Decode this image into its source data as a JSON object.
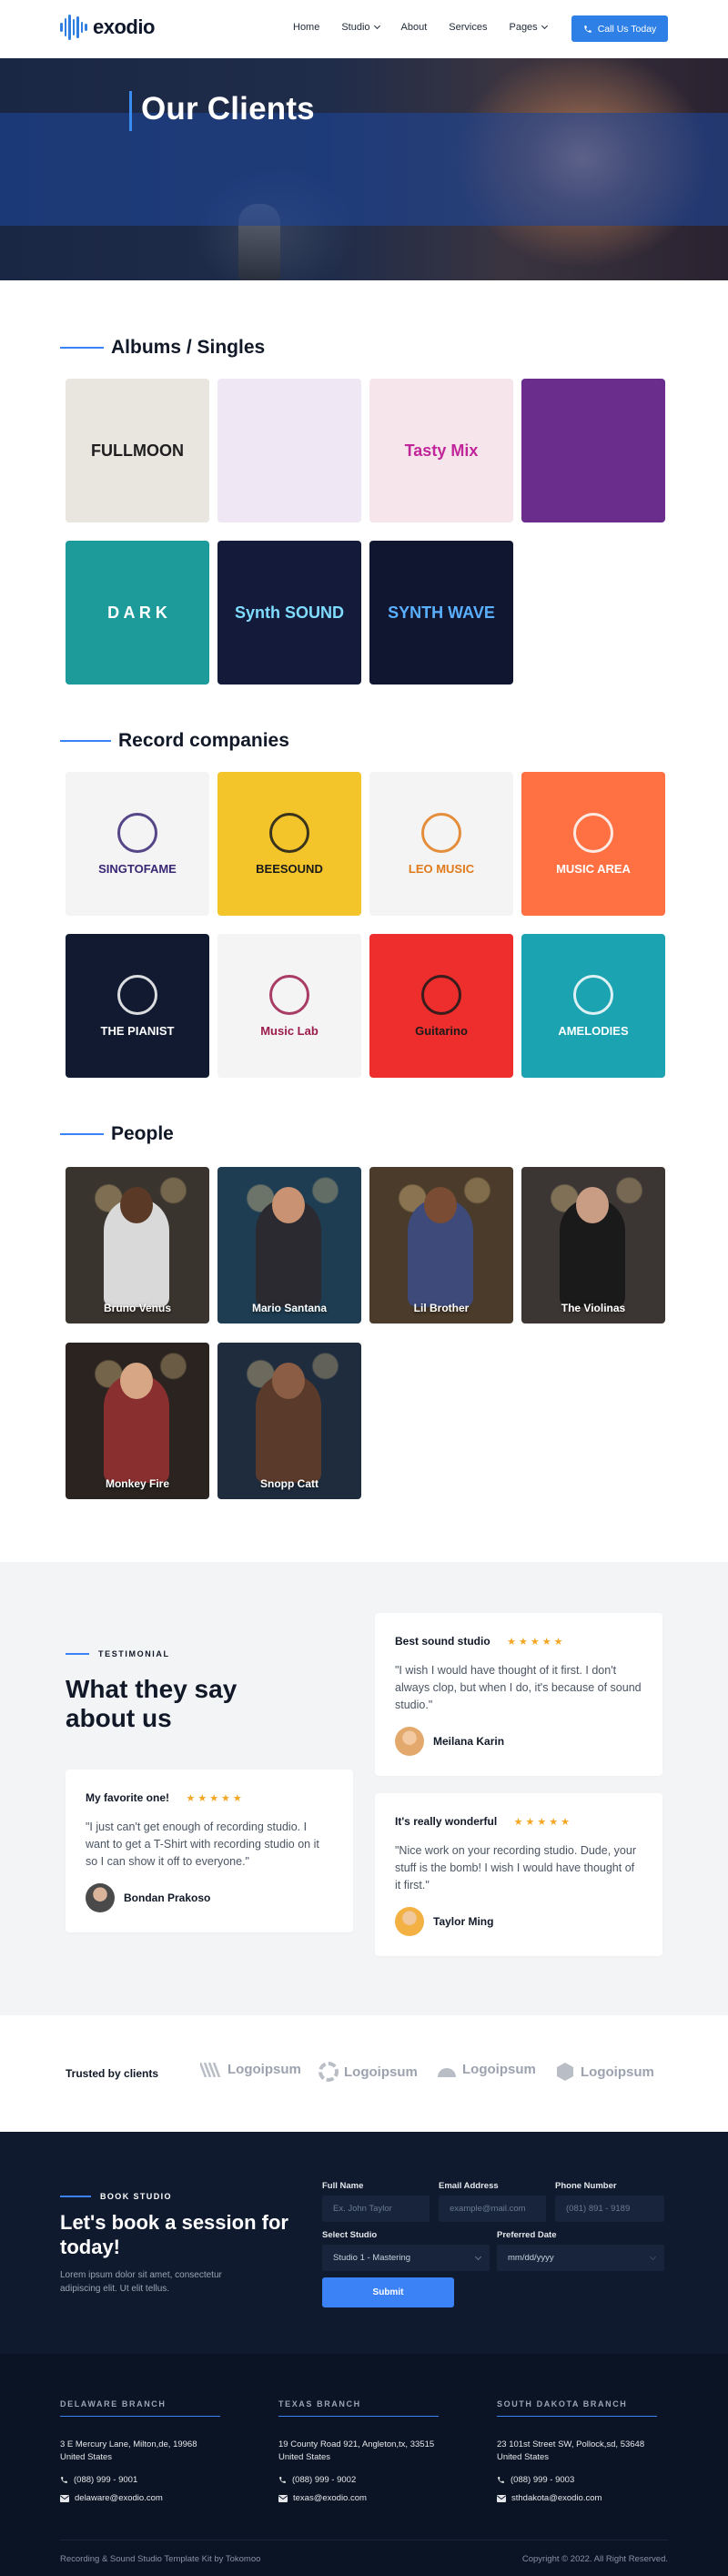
{
  "header": {
    "logo": "exodio",
    "nav": [
      {
        "label": "Home",
        "dropdown": false
      },
      {
        "label": "Studio",
        "dropdown": true
      },
      {
        "label": "About",
        "dropdown": false
      },
      {
        "label": "Services",
        "dropdown": false
      },
      {
        "label": "Pages",
        "dropdown": true
      }
    ],
    "cta": "Call Us Today"
  },
  "hero": {
    "title": "Our Clients"
  },
  "albums": {
    "heading": "Albums / Singles",
    "items": [
      {
        "label": "FULLMOON",
        "bg": "#e9e5df",
        "fg": "#1f1f1f"
      },
      {
        "label": "",
        "bg": "#efe7f4",
        "fg": "#6b7280"
      },
      {
        "label": "Tasty Mix",
        "bg": "#f6e6ec",
        "fg": "#c0269a"
      },
      {
        "label": "",
        "bg": "#6a2d8c",
        "fg": "#ffffff"
      },
      {
        "label": "D A R K",
        "bg": "#1d9a9a",
        "fg": "#ffffff"
      },
      {
        "label": "Synth SOUND",
        "bg": "#141a3a",
        "fg": "#7fdcff"
      },
      {
        "label": "SYNTH WAVE",
        "bg": "#101530",
        "fg": "#5ab0ff"
      }
    ]
  },
  "records": {
    "heading": "Record companies",
    "items": [
      {
        "label": "SINGTOFAME",
        "bg": "#f4f4f5",
        "fg": "#3a2774"
      },
      {
        "label": "BEESOUND",
        "bg": "#f4c52a",
        "fg": "#1a1a1a"
      },
      {
        "label": "LEO MUSIC",
        "bg": "#f4f4f5",
        "fg": "#e07a1a"
      },
      {
        "label": "MUSIC AREA",
        "bg": "#ff7043",
        "fg": "#ffffff"
      },
      {
        "label": "THE PIANIST",
        "bg": "#111a30",
        "fg": "#ffffff"
      },
      {
        "label": "Music Lab",
        "bg": "#f4f4f5",
        "fg": "#9b1b4b"
      },
      {
        "label": "Guitarino",
        "bg": "#ee2d2d",
        "fg": "#1a1a1a"
      },
      {
        "label": "AMELODIES",
        "bg": "#1ba3b1",
        "fg": "#ffffff"
      }
    ]
  },
  "people": {
    "heading": "People",
    "items": [
      {
        "name": "Bruno Venus",
        "bg": "#3a342e",
        "skin": "#5a3a26",
        "shirt": "#d9d9d9"
      },
      {
        "name": "Mario Santana",
        "bg": "#1e3d52",
        "skin": "#c99272",
        "shirt": "#2a2a30"
      },
      {
        "name": "Lil Brother",
        "bg": "#4a3b2a",
        "skin": "#7a4c34",
        "shirt": "#3d4a7a"
      },
      {
        "name": "The Violinas",
        "bg": "#3b3634",
        "skin": "#c99d84",
        "shirt": "#1a1a1a"
      },
      {
        "name": "Monkey Fire",
        "bg": "#2a2320",
        "skin": "#d7a685",
        "shirt": "#8a2f2f"
      },
      {
        "name": "Snopp Catt",
        "bg": "#1e2c3e",
        "skin": "#8a5d44",
        "shirt": "#5a3a2a"
      }
    ]
  },
  "testimonials": {
    "label": "TESTIMONIAL",
    "title": "What they say about us",
    "cards": [
      {
        "title": "Best sound studio",
        "stars": "★★★★★",
        "quote": "\"I wish I would have thought of it first. I don't always clop, but when I do, it's because of sound studio.\"",
        "name": "Meilana Karin",
        "avatar": "#e3a96c"
      },
      {
        "title": "My favorite one!",
        "stars": "★★★★★",
        "quote": "\"I just can't get enough of recording studio. I want to get a T-Shirt with recording studio on it so I can show it off to everyone.\"",
        "name": "Bondan Prakoso",
        "avatar": "#8d6e63"
      },
      {
        "title": "It's really wonderful",
        "stars": "★★★★★",
        "quote": "\"Nice work on your recording studio. Dude, your stuff is the bomb! I wish I would have thought of it first.\"",
        "name": "Taylor Ming",
        "avatar": "#f2b142"
      }
    ]
  },
  "trusted": {
    "label": "Trusted by clients",
    "logos": [
      "Logoipsum",
      "Logoipsum",
      "Logoipsum",
      "Logoipsum"
    ]
  },
  "booking": {
    "label": "BOOK STUDIO",
    "title": "Let's book a session for today!",
    "subtitle": "Lorem ipsum dolor sit amet, consectetur adipiscing elit. Ut elit tellus.",
    "fields": {
      "full_name": {
        "label": "Full Name",
        "placeholder": "Ex. John Taylor"
      },
      "email": {
        "label": "Email Address",
        "placeholder": "example@mail.com"
      },
      "phone": {
        "label": "Phone Number",
        "placeholder": "(081) 891 - 9189"
      },
      "studio": {
        "label": "Select Studio",
        "value": "Studio 1 - Mastering"
      },
      "date": {
        "label": "Preferred Date",
        "placeholder": "mm/dd/yyyy"
      }
    },
    "submit": "Submit"
  },
  "footer": {
    "branches": [
      {
        "title": "DELAWARE BRANCH",
        "address": "3 E Mercury Lane, Milton,de, 19968 United States",
        "phone": "(088) 999 - 9001",
        "email": "delaware@exodio.com"
      },
      {
        "title": "TEXAS BRANCH",
        "address": "19 County Road 921, Angleton,tx, 33515 United States",
        "phone": "(088) 999 - 9002",
        "email": "texas@exodio.com"
      },
      {
        "title": "SOUTH DAKOTA BRANCH",
        "address": "23 101st Street SW, Pollock,sd, 53648 United States",
        "phone": "(088) 999 - 9003",
        "email": "sthdakota@exodio.com"
      }
    ],
    "credit": "Recording & Sound Studio Template Kit by Tokomoo",
    "copyright": "Copyright © 2022. All Right Reserved."
  }
}
